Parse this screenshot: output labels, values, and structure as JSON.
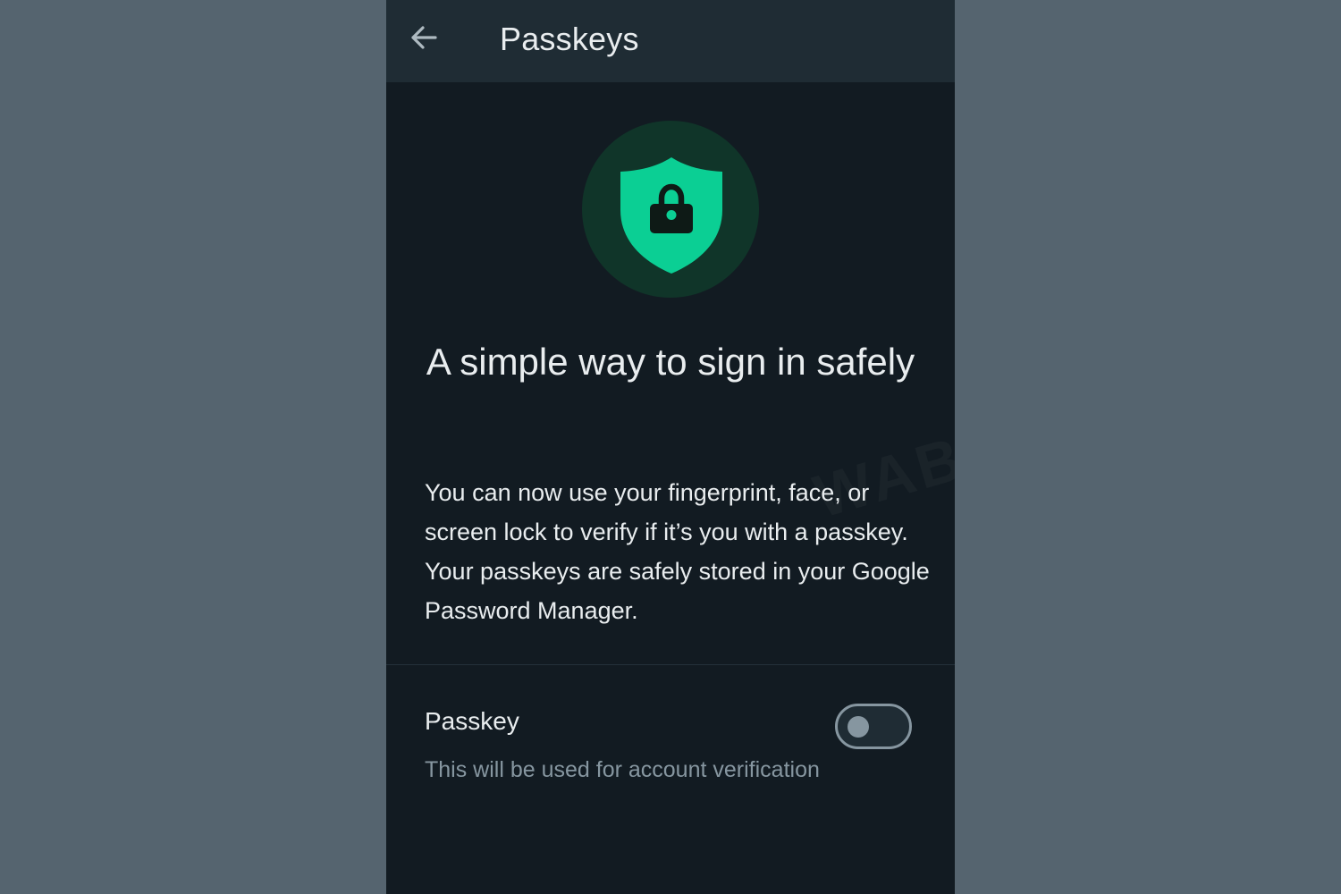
{
  "app_bar": {
    "title": "Passkeys",
    "back_icon": "arrow-left-icon"
  },
  "hero": {
    "icon": "shield-lock-icon",
    "headline": "A simple way to sign in safely"
  },
  "body": {
    "description": "You can now use your fingerprint, face, or screen lock to verify if it’s you with a passkey. Your passkeys are safely stored in your Google Password Manager."
  },
  "setting": {
    "label": "Passkey",
    "sublabel": "This will be used for account verification",
    "enabled": false
  },
  "colors": {
    "background": "#55646f",
    "screen": "#121b22",
    "app_bar": "#1f2c34",
    "accent": "#0bcf94",
    "hero_circle": "#103529",
    "text_primary": "#e9edef",
    "text_secondary": "#8696a0"
  },
  "watermark": "WABETAINFO"
}
